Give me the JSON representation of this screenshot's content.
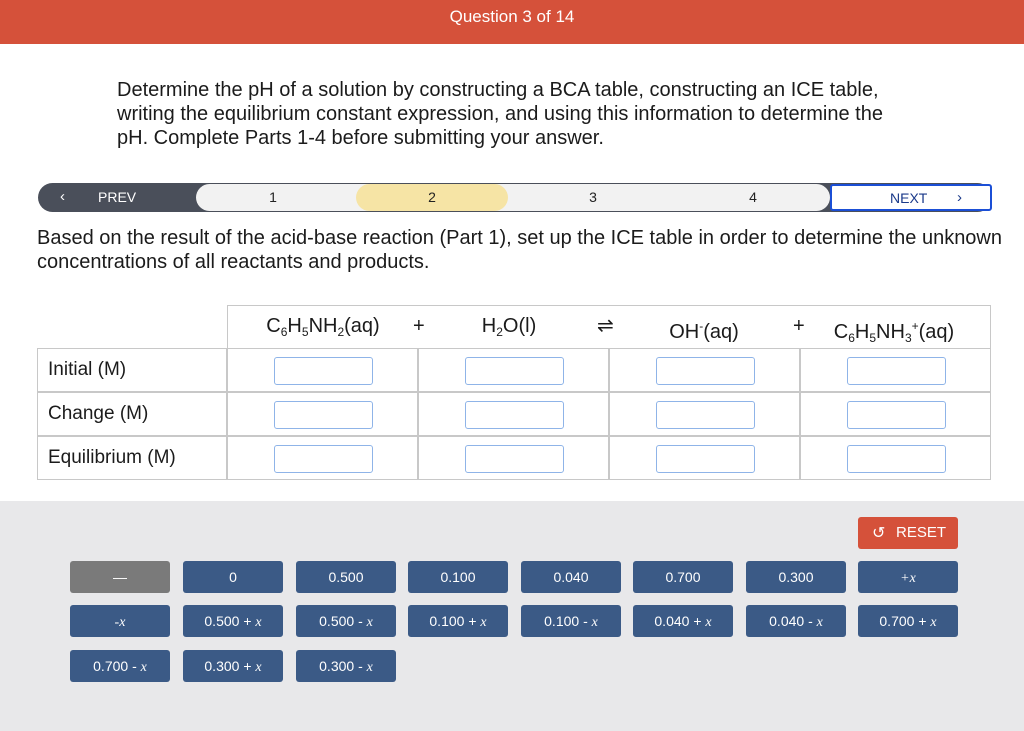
{
  "header": {
    "title": "Question 3 of 14"
  },
  "prompt": "Determine the pH of a solution by constructing a BCA table, constructing an ICE table, writing the equilibrium constant expression, and using this information to determine the pH. Complete Parts 1-4 before submitting your answer.",
  "nav": {
    "prev_label": "PREV",
    "next_label": "NEXT",
    "steps": [
      "1",
      "2",
      "3",
      "4"
    ],
    "active_step": "2"
  },
  "instruction": "Based on the result of the acid-base reaction (Part 1), set up the ICE table in order to determine the unknown concentrations of all reactants and products.",
  "ice": {
    "plus": "+",
    "equilibrium_arrow": "⇌",
    "rows": [
      "Initial (M)",
      "Change (M)",
      "Equilibrium (M)"
    ]
  },
  "tray": {
    "reset_label": "RESET",
    "tiles": {
      "blank": "—",
      "zero": "0",
      "t0500": "0.500",
      "t0100": "0.100",
      "t0040": "0.040",
      "t0700": "0.700",
      "t0300": "0.300",
      "plus_x": "+x",
      "minus_x": "-x",
      "t0500px": "0.500 + ",
      "t0500mx": "0.500 - ",
      "t0100px": "0.100 + ",
      "t0100mx": "0.100 - ",
      "t0040px": "0.040 + ",
      "t0040mx": "0.040 - ",
      "t0700px": "0.700 + ",
      "t0700mx": "0.700 - ",
      "t0300px": "0.300 + ",
      "t0300mx": "0.300 - ",
      "var": "x"
    }
  },
  "colors": {
    "header": "#d5513a",
    "tile": "#3b5a86",
    "tile_blank": "#7a7a7a",
    "active_step": "#f6e4a5",
    "next_border": "#1b4fd6"
  }
}
